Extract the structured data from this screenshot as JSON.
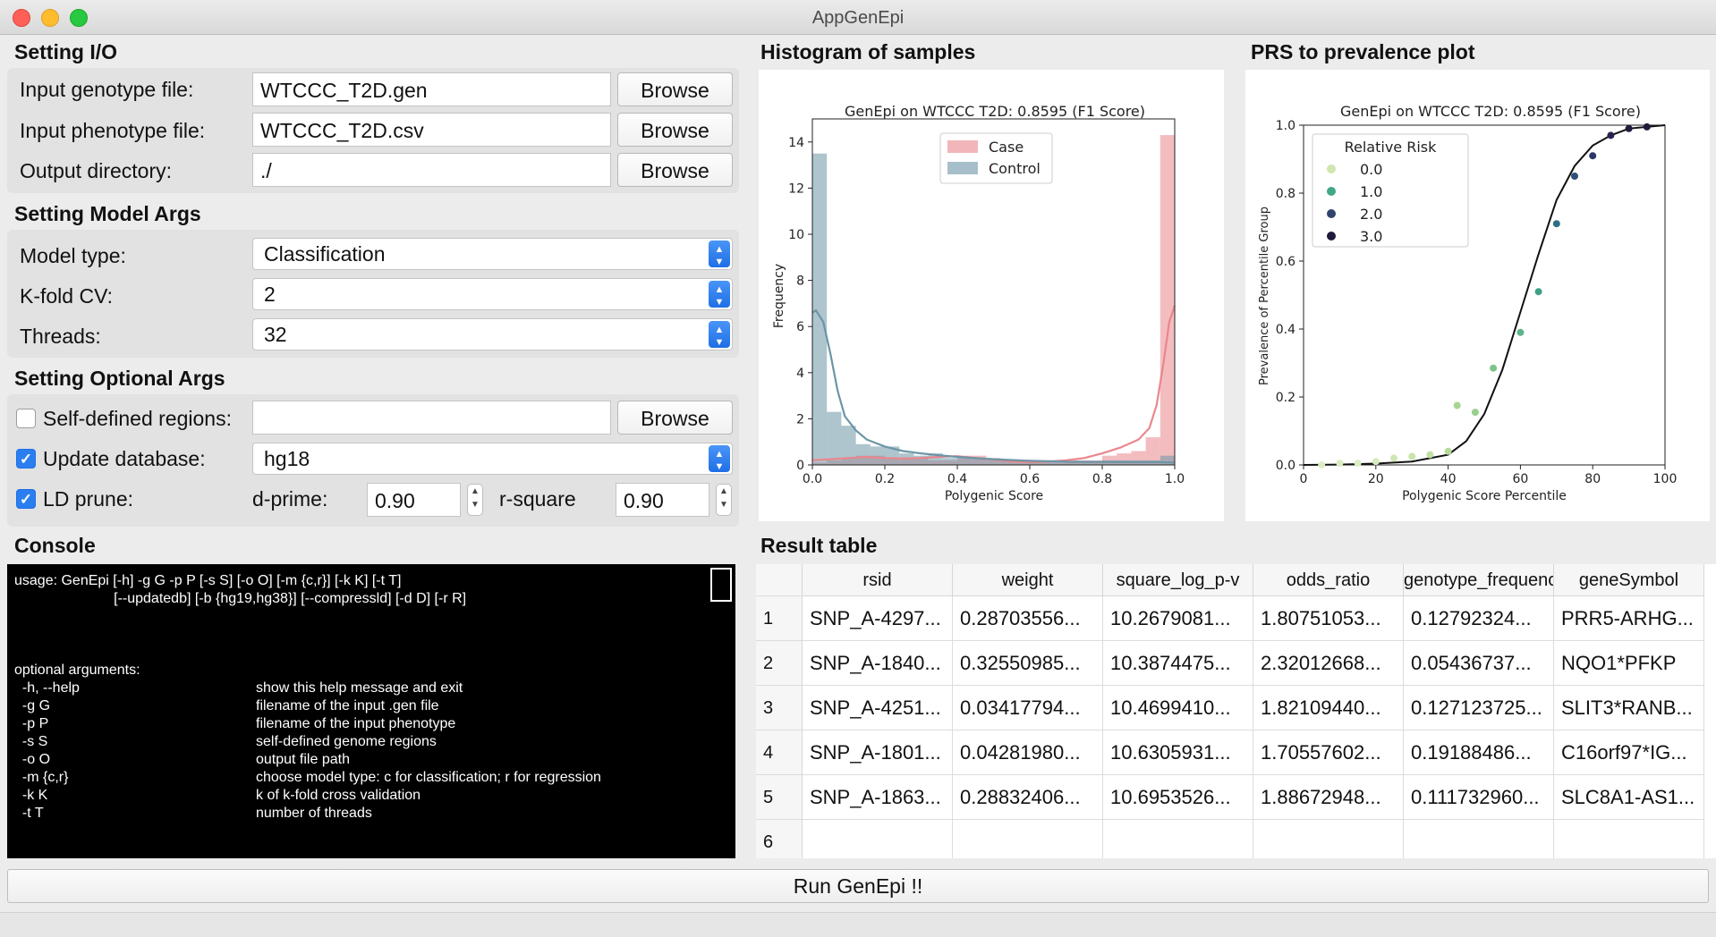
{
  "window": {
    "title": "AppGenEpi"
  },
  "io": {
    "section_title": "Setting I/O",
    "genotype_label": "Input genotype file:",
    "genotype_value": "WTCCC_T2D.gen",
    "phenotype_label": "Input phenotype file:",
    "phenotype_value": "WTCCC_T2D.csv",
    "output_label": "Output directory:",
    "output_value": "./",
    "browse_label": "Browse"
  },
  "model": {
    "section_title": "Setting Model Args",
    "type_label": "Model type:",
    "type_value": "Classification",
    "kfold_label": "K-fold CV:",
    "kfold_value": "2",
    "threads_label": "Threads:",
    "threads_value": "32"
  },
  "optional": {
    "section_title": "Setting Optional Args",
    "regions_label": "Self-defined regions:",
    "regions_value": "",
    "regions_checked": false,
    "update_label": "Update database:",
    "update_value": "hg18",
    "update_checked": true,
    "ld_label": "LD prune:",
    "ld_checked": true,
    "dprime_label": "d-prime:",
    "dprime_value": "0.90",
    "rsquare_label": "r-square",
    "rsquare_value": "0.90"
  },
  "console": {
    "title": "Console",
    "lines": [
      "usage: GenEpi [-h] -g G -p P [-s S] [-o O] [-m {c,r}] [-k K] [-t T]",
      "                         [--updatedb] [-b {hg19,hg38}] [--compressld] [-d D] [-r R]",
      "",
      "",
      "",
      "optional arguments:"
    ],
    "options": [
      {
        "flag": "  -h, --help",
        "desc": "show this help message and exit"
      },
      {
        "flag": "  -g G",
        "desc": "filename of the input .gen file"
      },
      {
        "flag": "  -p P",
        "desc": "filename of the input phenotype"
      },
      {
        "flag": "  -s S",
        "desc": "self-defined genome regions"
      },
      {
        "flag": "  -o O",
        "desc": "output file path"
      },
      {
        "flag": "  -m {c,r}",
        "desc": "choose model type: c for classification; r for regression"
      },
      {
        "flag": "  -k K",
        "desc": "k of k-fold cross validation"
      },
      {
        "flag": "  -t T",
        "desc": "number of threads"
      }
    ]
  },
  "histogram": {
    "section_title": "Histogram of samples",
    "chart_data": {
      "type": "histogram",
      "title": "GenEpi on WTCCC T2D: 0.8595 (F1 Score)",
      "xlabel": "Polygenic Score",
      "ylabel": "Frequency",
      "xlim": [
        0,
        1
      ],
      "ylim": [
        0,
        15
      ],
      "xticks": [
        "0.0",
        "0.2",
        "0.4",
        "0.6",
        "0.8",
        "1.0"
      ],
      "yticks": [
        "0",
        "2",
        "4",
        "6",
        "8",
        "10",
        "12",
        "14"
      ],
      "legend_position": "top-center",
      "bin_edges": [
        0,
        0.04,
        0.08,
        0.12,
        0.16,
        0.2,
        0.24,
        0.28,
        0.32,
        0.36,
        0.4,
        0.44,
        0.48,
        0.52,
        0.56,
        0.6,
        0.64,
        0.68,
        0.72,
        0.76,
        0.8,
        0.84,
        0.88,
        0.92,
        0.96,
        1.0
      ],
      "series": [
        {
          "name": "Case",
          "color": "#e9868c",
          "bars": [
            0.1,
            0.2,
            0.3,
            0.4,
            0.4,
            0.3,
            0.3,
            0.3,
            0.2,
            0.2,
            0.4,
            0.4,
            0.3,
            0.2,
            0.1,
            0.1,
            0.1,
            0.1,
            0.2,
            0.2,
            0.4,
            0.5,
            0.6,
            1.2,
            14.3
          ],
          "kde": [
            [
              0,
              0.2
            ],
            [
              0.05,
              0.25
            ],
            [
              0.1,
              0.3
            ],
            [
              0.15,
              0.35
            ],
            [
              0.2,
              0.3
            ],
            [
              0.25,
              0.28
            ],
            [
              0.3,
              0.3
            ],
            [
              0.35,
              0.35
            ],
            [
              0.4,
              0.38
            ],
            [
              0.45,
              0.3
            ],
            [
              0.5,
              0.22
            ],
            [
              0.55,
              0.15
            ],
            [
              0.6,
              0.12
            ],
            [
              0.65,
              0.14
            ],
            [
              0.7,
              0.2
            ],
            [
              0.75,
              0.3
            ],
            [
              0.8,
              0.5
            ],
            [
              0.85,
              0.75
            ],
            [
              0.9,
              1.1
            ],
            [
              0.93,
              1.6
            ],
            [
              0.95,
              2.6
            ],
            [
              0.97,
              4.5
            ],
            [
              0.985,
              6.2
            ],
            [
              1.0,
              6.9
            ]
          ]
        },
        {
          "name": "Control",
          "color": "#6c95a6",
          "bars": [
            13.5,
            2.3,
            1.7,
            0.9,
            0.8,
            0.8,
            0.5,
            0.4,
            0.5,
            0.3,
            0.3,
            0.3,
            0.2,
            0.2,
            0.2,
            0.2,
            0.2,
            0.1,
            0.1,
            0.1,
            0.2,
            0.2,
            0.2,
            0.2,
            0.4
          ],
          "kde": [
            [
              0,
              6.6
            ],
            [
              0.01,
              6.7
            ],
            [
              0.03,
              6.2
            ],
            [
              0.05,
              4.8
            ],
            [
              0.07,
              3.2
            ],
            [
              0.09,
              2.1
            ],
            [
              0.12,
              1.5
            ],
            [
              0.15,
              1.1
            ],
            [
              0.2,
              0.8
            ],
            [
              0.25,
              0.6
            ],
            [
              0.3,
              0.5
            ],
            [
              0.35,
              0.42
            ],
            [
              0.4,
              0.35
            ],
            [
              0.5,
              0.25
            ],
            [
              0.6,
              0.18
            ],
            [
              0.7,
              0.14
            ],
            [
              0.8,
              0.13
            ],
            [
              0.9,
              0.12
            ],
            [
              0.95,
              0.12
            ],
            [
              1.0,
              0.1
            ]
          ]
        }
      ]
    }
  },
  "prs": {
    "section_title": "PRS to prevalence plot",
    "chart_data": {
      "type": "scatter",
      "title": "GenEpi on WTCCC T2D: 0.8595 (F1 Score)",
      "xlabel": "Polygenic Score Percentile",
      "ylabel": "Prevalence of Percentile Group",
      "xlim": [
        0,
        100
      ],
      "ylim": [
        0,
        1
      ],
      "xticks": [
        "0",
        "20",
        "40",
        "60",
        "80",
        "100"
      ],
      "yticks": [
        "0.0",
        "0.2",
        "0.4",
        "0.6",
        "0.8",
        "1.0"
      ],
      "legend_title": "Relative Risk",
      "legend_position": "top-left",
      "legend": [
        {
          "label": "0.0",
          "color": "#cfe6b0"
        },
        {
          "label": "1.0",
          "color": "#3fa889"
        },
        {
          "label": "2.0",
          "color": "#2f456e"
        },
        {
          "label": "3.0",
          "color": "#221a3a"
        }
      ],
      "points": [
        [
          5,
          0.0,
          "#dcedc4"
        ],
        [
          10,
          0.005,
          "#dcedc4"
        ],
        [
          15,
          0.005,
          "#dcedc4"
        ],
        [
          20,
          0.01,
          "#d6ebbd"
        ],
        [
          25,
          0.02,
          "#d0e7b5"
        ],
        [
          30,
          0.025,
          "#c8e4ac"
        ],
        [
          35,
          0.03,
          "#c0e0a3"
        ],
        [
          40,
          0.04,
          "#b5db99"
        ],
        [
          42.5,
          0.175,
          "#a8d590"
        ],
        [
          47.5,
          0.155,
          "#97ce8b"
        ],
        [
          52.5,
          0.285,
          "#7fc38a"
        ],
        [
          60,
          0.39,
          "#5db48a"
        ],
        [
          65,
          0.51,
          "#3fa08a"
        ],
        [
          70,
          0.71,
          "#2e6f84"
        ],
        [
          75,
          0.85,
          "#2f4f7a"
        ],
        [
          80,
          0.91,
          "#2b3768"
        ],
        [
          85,
          0.97,
          "#26244f"
        ],
        [
          90,
          0.99,
          "#221a3a"
        ],
        [
          95,
          0.995,
          "#221a3a"
        ]
      ],
      "curve": [
        [
          0,
          0.0
        ],
        [
          10,
          0.001
        ],
        [
          20,
          0.004
        ],
        [
          30,
          0.01
        ],
        [
          40,
          0.03
        ],
        [
          45,
          0.07
        ],
        [
          50,
          0.15
        ],
        [
          55,
          0.28
        ],
        [
          60,
          0.45
        ],
        [
          65,
          0.62
        ],
        [
          70,
          0.78
        ],
        [
          75,
          0.88
        ],
        [
          80,
          0.94
        ],
        [
          85,
          0.97
        ],
        [
          90,
          0.99
        ],
        [
          95,
          0.995
        ],
        [
          100,
          1.0
        ]
      ]
    }
  },
  "results": {
    "section_title": "Result table",
    "columns": [
      "rsid",
      "weight",
      "square_log_p-v",
      "odds_ratio",
      "genotype_frequenc",
      "geneSymbol"
    ],
    "rows": [
      {
        "n": "1",
        "cells": [
          "SNP_A-4297...",
          "0.28703556...",
          "10.2679081...",
          "1.80751053...",
          "0.12792324...",
          "PRR5-ARHG..."
        ]
      },
      {
        "n": "2",
        "cells": [
          "SNP_A-1840...",
          "0.32550985...",
          "10.3874475...",
          "2.32012668...",
          "0.05436737...",
          "NQO1*PFKP"
        ]
      },
      {
        "n": "3",
        "cells": [
          "SNP_A-4251...",
          "0.03417794...",
          "10.4699410...",
          "1.82109440...",
          "0.127123725...",
          "SLIT3*RANB..."
        ]
      },
      {
        "n": "4",
        "cells": [
          "SNP_A-1801...",
          "0.04281980...",
          "10.6305931...",
          "1.70557602...",
          "0.19188486...",
          "C16orf97*IG..."
        ]
      },
      {
        "n": "5",
        "cells": [
          "SNP_A-1863...",
          "0.28832406...",
          "10.6953526...",
          "1.88672948...",
          "0.111732960...",
          "SLC8A1-AS1..."
        ]
      },
      {
        "n": "6",
        "cells": [
          "",
          "",
          "",
          "",
          "",
          ""
        ]
      }
    ]
  },
  "run": {
    "label": "Run GenEpi !!"
  }
}
